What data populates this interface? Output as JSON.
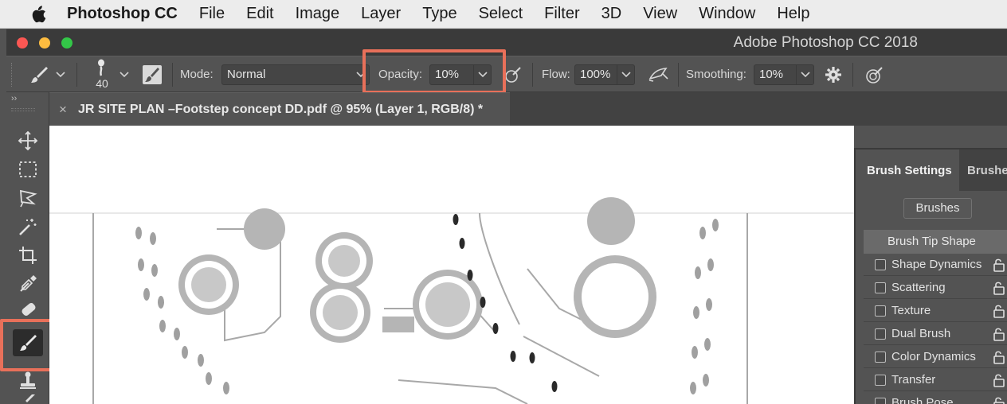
{
  "menubar": {
    "apple_icon": "apple-logo",
    "app_name": "Photoshop CC",
    "items": [
      "File",
      "Edit",
      "Image",
      "Layer",
      "Type",
      "Select",
      "Filter",
      "3D",
      "View",
      "Window",
      "Help"
    ]
  },
  "window": {
    "title": "Adobe Photoshop CC 2018",
    "traffic_lights": [
      "#fc5753",
      "#fdbc40",
      "#33c748"
    ]
  },
  "options": {
    "brush_size": "40",
    "mode_label": "Mode:",
    "mode_value": "Normal",
    "opacity_label": "Opacity:",
    "opacity_value": "10%",
    "flow_label": "Flow:",
    "flow_value": "100%",
    "smoothing_label": "Smoothing:",
    "smoothing_value": "10%"
  },
  "document": {
    "tab_title": "JR SITE PLAN –Footstep concept DD.pdf @ 95% (Layer 1, RGB/8) *",
    "close_glyph": "×"
  },
  "panel": {
    "tabs": [
      "Brush Settings",
      "Brushes"
    ],
    "brushes_button": "Brushes",
    "tip_shape": "Brush Tip Shape",
    "options": [
      "Shape Dynamics",
      "Scattering",
      "Texture",
      "Dual Brush",
      "Color Dynamics",
      "Transfer",
      "Brush Pose"
    ]
  },
  "toolbar": {
    "tools": [
      "move-tool",
      "marquee-tool",
      "lasso-tool",
      "magic-wand-tool",
      "crop-tool",
      "eyedropper-tool",
      "healing-brush-tool",
      "brush-tool",
      "clone-stamp-tool",
      "history-brush-tool"
    ],
    "active_tool": "brush-tool"
  },
  "colors": {
    "highlight": "#e8705a",
    "panel_bg": "#535353",
    "canvas_bg": "#ffffff"
  }
}
